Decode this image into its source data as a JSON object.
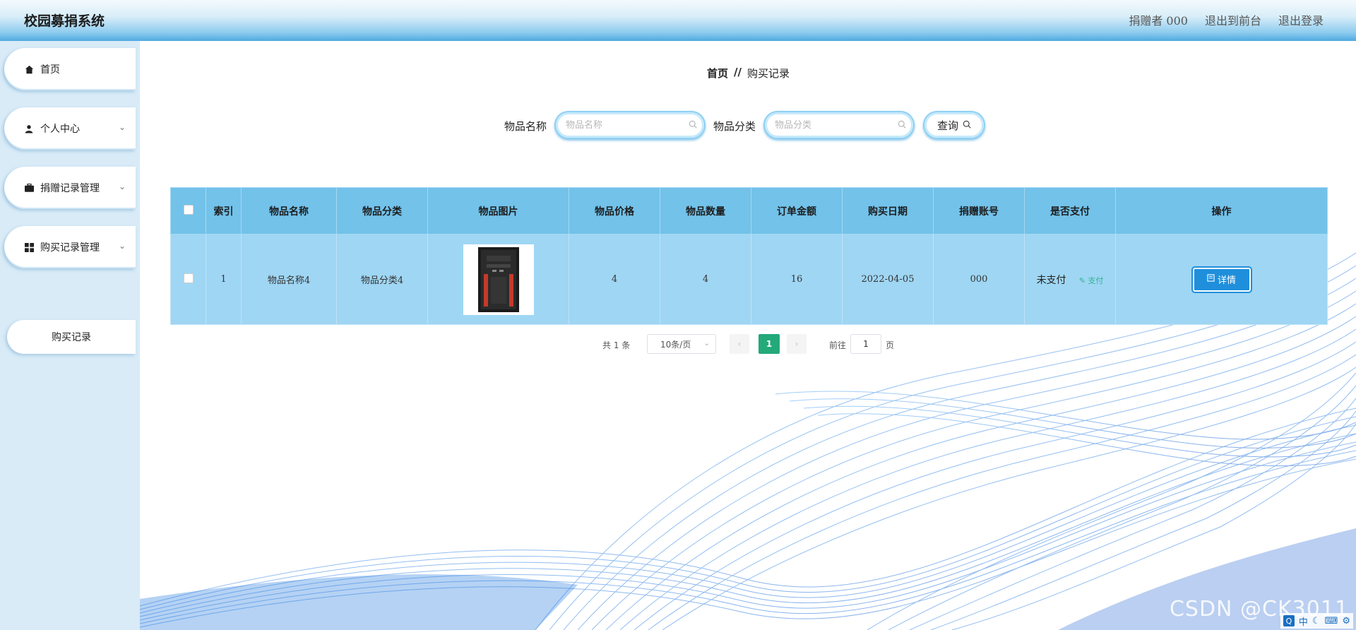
{
  "header": {
    "title": "校园募捐系统",
    "user_label": "捐赠者 000",
    "to_front_label": "退出到前台",
    "logout_label": "退出登录"
  },
  "sidebar": {
    "items": [
      {
        "label": "首页",
        "icon": "home-icon"
      },
      {
        "label": "个人中心",
        "icon": "user-icon"
      },
      {
        "label": "捐赠记录管理",
        "icon": "briefcase-icon"
      },
      {
        "label": "购买记录管理",
        "icon": "grid-icon"
      }
    ],
    "sub_item": "购买记录"
  },
  "breadcrumb": {
    "home": "首页",
    "separator": "//",
    "current": "购买记录"
  },
  "search": {
    "name_label": "物品名称",
    "name_placeholder": "物品名称",
    "category_label": "物品分类",
    "category_placeholder": "物品分类",
    "query_label": "查询"
  },
  "table": {
    "headers": [
      "索引",
      "物品名称",
      "物品分类",
      "物品图片",
      "物品价格",
      "物品数量",
      "订单金额",
      "购买日期",
      "捐赠账号",
      "是否支付",
      "操作"
    ],
    "rows": [
      {
        "index": "1",
        "name": "物品名称4",
        "category": "物品分类4",
        "price": "4",
        "quantity": "4",
        "amount": "16",
        "date": "2022-04-05",
        "account": "000",
        "paid": "未支付",
        "pay_link": "支付",
        "detail_label": "详情"
      }
    ]
  },
  "pagination": {
    "total": "共 1 条",
    "page_size": "10条/页",
    "current_page": "1",
    "goto_label": "前往",
    "goto_value": "1",
    "page_suffix": "页"
  },
  "watermark": "CSDN @CK3011",
  "colors": {
    "header_bottom": "#4fa9e0",
    "table_header": "#72c2ea",
    "table_row": "#9fd6f3",
    "detail_button": "#1f8fdc",
    "current_page": "#23a97a"
  }
}
